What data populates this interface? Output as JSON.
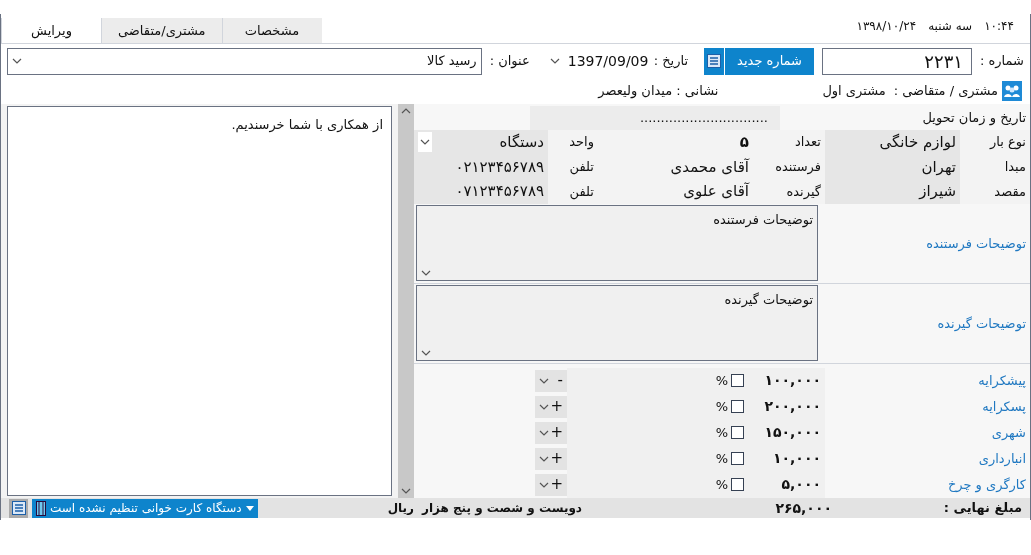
{
  "clock": {
    "time": "۱۰:۴۴",
    "weekday": "سه شنبه",
    "date": "۱۳۹۸/۱۰/۲۴"
  },
  "tabs": [
    {
      "label": "مشخصات",
      "selected": false
    },
    {
      "label": "مشتری/متقاضی",
      "selected": false
    },
    {
      "label": "ویرایش",
      "selected": true
    }
  ],
  "header": {
    "number_label": "شماره :",
    "number": "۲۲۳۱",
    "new_number_button": "شماره جدید",
    "date_label": "تاریخ :",
    "date": "1397/09/09",
    "title_label": "عنوان :",
    "title": "رسید کالا",
    "customer_label": "مشتری / متقاضی :",
    "customer": "مشتری اول",
    "address_label": "نشانی :",
    "address": "میدان ولیعصر"
  },
  "notes": "از همکاری با شما خرسندیم.",
  "delivery": {
    "label": "تاریخ و زمان تحویل",
    "value": "..............................."
  },
  "cargo_rows": [
    [
      {
        "kind": "text",
        "label": "نوع بار",
        "value": "لوازم خانگی"
      },
      {
        "kind": "number",
        "label": "تعداد",
        "value": "۵"
      },
      {
        "kind": "select",
        "label": "واحد",
        "value": "دستگاه"
      }
    ],
    [
      {
        "kind": "text",
        "label": "مبدا",
        "value": "تهران"
      },
      {
        "kind": "text",
        "label": "فرستنده",
        "value": "آقای محمدی"
      },
      {
        "kind": "text",
        "label": "تلفن",
        "value": "۰۲۱۲۳۴۵۶۷۸۹"
      }
    ],
    [
      {
        "kind": "text",
        "label": "مقصد",
        "value": "شیراز"
      },
      {
        "kind": "text",
        "label": "گیرنده",
        "value": "آقای علوی"
      },
      {
        "kind": "text",
        "label": "تلفن",
        "value": "۰۷۱۲۳۴۵۶۷۸۹"
      }
    ]
  ],
  "note_boxes": [
    {
      "label": "توضیحات فرستنده",
      "value": "توضیحات فرستنده"
    },
    {
      "label": "توضیحات گیرنده",
      "value": "توضیحات گیرنده"
    }
  ],
  "fees": [
    {
      "label": "پیشکرایه",
      "amount": "۱۰۰,۰۰۰",
      "checked": false,
      "unit": "%",
      "sign": "-"
    },
    {
      "label": "پسکرایه",
      "amount": "۲۰۰,۰۰۰",
      "checked": false,
      "unit": "%",
      "sign": "+"
    },
    {
      "label": "شهری",
      "amount": "۱۵۰,۰۰۰",
      "checked": false,
      "unit": "%",
      "sign": "+"
    },
    {
      "label": "انبارداری",
      "amount": "۱۰,۰۰۰",
      "checked": false,
      "unit": "%",
      "sign": "+"
    },
    {
      "label": "کارگری و چرخ",
      "amount": "۵,۰۰۰",
      "checked": false,
      "unit": "%",
      "sign": "+"
    }
  ],
  "total": {
    "label": "مبلغ نهایی :",
    "amount": "۲۶۵,۰۰۰",
    "words": "دویست و شصت و پنج هزار",
    "currency": "ریال"
  },
  "card_reader": "دستگاه کارت خوانی تنظیم نشده است"
}
